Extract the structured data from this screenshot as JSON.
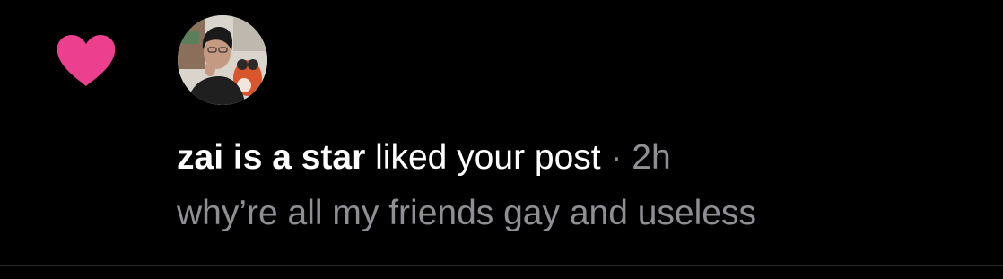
{
  "notification": {
    "type_icon": "heart-icon",
    "username": "zai is a star",
    "action": "liked your post",
    "separator": "·",
    "time": "2h",
    "post_text": "why’re all my friends gay and useless"
  },
  "colors": {
    "background": "#000000",
    "heart": "#ec3f8e",
    "primary_text": "#ffffff",
    "secondary_text": "#8e8e93",
    "divider": "#2a2a2c"
  }
}
